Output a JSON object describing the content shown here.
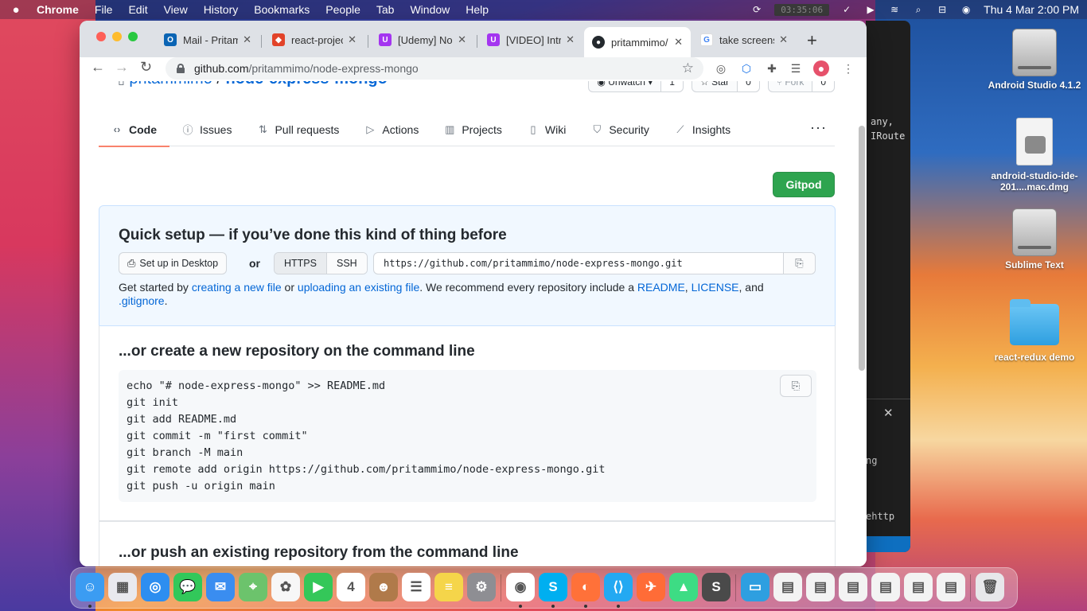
{
  "menubar": {
    "app": "Chrome",
    "items": [
      "File",
      "Edit",
      "View",
      "History",
      "Bookmarks",
      "People",
      "Tab",
      "Window",
      "Help"
    ],
    "timer": "03:35:06",
    "datetime": "Thu 4 Mar  2:00 PM"
  },
  "browser": {
    "tabs": [
      {
        "title": "Mail - Pritam",
        "icon": "outlook-icon",
        "color": "#0a64b4"
      },
      {
        "title": "react-project",
        "icon": "gitlab-icon",
        "color": "#e24329"
      },
      {
        "title": "[Udemy] Node",
        "icon": "udemy-icon",
        "color": "#a435f0"
      },
      {
        "title": "[VIDEO] Intro",
        "icon": "udemy-icon",
        "color": "#a435f0"
      },
      {
        "title": "pritammimo/",
        "icon": "github-icon",
        "color": "#24292e"
      },
      {
        "title": "take screens",
        "icon": "google-icon",
        "color": "#4285f4"
      }
    ],
    "url_domain": "github.com",
    "url_path": "/pritammimo/node-express-mongo"
  },
  "repo": {
    "owner": "pritammimo",
    "separator": " / ",
    "name": "node-express-mongo",
    "watch": {
      "label": "Unwatch",
      "count": "1"
    },
    "star": {
      "label": "Star",
      "count": "0"
    },
    "fork": {
      "label": "Fork",
      "count": "0"
    }
  },
  "nav": {
    "items": [
      {
        "label": "Code",
        "icon": "code-icon"
      },
      {
        "label": "Issues",
        "icon": "issue-icon"
      },
      {
        "label": "Pull requests",
        "icon": "pull-request-icon"
      },
      {
        "label": "Actions",
        "icon": "play-icon"
      },
      {
        "label": "Projects",
        "icon": "project-icon"
      },
      {
        "label": "Wiki",
        "icon": "book-icon"
      },
      {
        "label": "Security",
        "icon": "shield-icon"
      },
      {
        "label": "Insights",
        "icon": "graph-icon"
      }
    ],
    "more": "···"
  },
  "gitpod_label": "Gitpod",
  "quick_setup": {
    "title": "Quick setup — if you’ve done this kind of thing before",
    "desktop_btn": "Set up in Desktop",
    "or": "or",
    "https": "HTTPS",
    "ssh": "SSH",
    "clone_url": "https://github.com/pritammimo/node-express-mongo.git",
    "desc_1": "Get started by ",
    "link_new_file": "creating a new file",
    "desc_2": " or ",
    "link_upload": "uploading an existing file",
    "desc_3": ". We recommend every repository include a ",
    "link_readme": "README",
    "desc_4": ", ",
    "link_license": "LICENSE",
    "desc_5": ", and ",
    "link_gitignore": ".gitignore",
    "desc_6": "."
  },
  "cmd_new": {
    "title": "...or create a new repository on the command line",
    "code": "echo \"# node-express-mongo\" >> README.md\ngit init\ngit add README.md\ngit commit -m \"first commit\"\ngit branch -M main\ngit remote add origin https://github.com/pritammimo/node-express-mongo.git\ngit push -u origin main"
  },
  "cmd_push": {
    "title": "...or push an existing repository from the command line"
  },
  "desktop": {
    "icons": [
      {
        "label": "Android Studio 4.1.2",
        "kind": "disk"
      },
      {
        "label": "android-studio-ide-201....mac.dmg",
        "kind": "dmg"
      },
      {
        "label": "Sublime Text",
        "kind": "disk"
      },
      {
        "label": "react-redux demo",
        "kind": "folder"
      }
    ]
  },
  "bg_window": {
    "line1": "any,",
    "line2": "IRoute",
    "line3": "ng",
    "line4": "ehttp"
  },
  "dock": {
    "apps": [
      {
        "name": "finder-icon",
        "color": "#3b9cf2",
        "glyph": "☺"
      },
      {
        "name": "launchpad-icon",
        "color": "#e9e9ee",
        "glyph": "▦"
      },
      {
        "name": "safari-icon",
        "color": "#2d8ef0",
        "glyph": "◎"
      },
      {
        "name": "messages-icon",
        "color": "#32c85a",
        "glyph": "💬"
      },
      {
        "name": "mail-icon",
        "color": "#3a8df0",
        "glyph": "✉"
      },
      {
        "name": "maps-icon",
        "color": "#6cc36c",
        "glyph": "⌖"
      },
      {
        "name": "photos-icon",
        "color": "#f7f7f7",
        "glyph": "✿"
      },
      {
        "name": "facetime-icon",
        "color": "#34c759",
        "glyph": "▶"
      },
      {
        "name": "calendar-icon",
        "color": "#ffffff",
        "glyph": "4"
      },
      {
        "name": "contacts-icon",
        "color": "#b07a4a",
        "glyph": "☻"
      },
      {
        "name": "reminders-icon",
        "color": "#ffffff",
        "glyph": "☰"
      },
      {
        "name": "notes-icon",
        "color": "#f5d54a",
        "glyph": "≡"
      },
      {
        "name": "system-preferences-icon",
        "color": "#8e8e93",
        "glyph": "⚙"
      },
      {
        "name": "chrome-icon",
        "color": "#ffffff",
        "glyph": "◉"
      },
      {
        "name": "skype-icon",
        "color": "#00aff0",
        "glyph": "S"
      },
      {
        "name": "firefox-icon",
        "color": "#ff7139",
        "glyph": "◐"
      },
      {
        "name": "vscode-icon",
        "color": "#23a9f2",
        "glyph": "⟨⟩"
      },
      {
        "name": "postman-icon",
        "color": "#ff6c37",
        "glyph": "✈"
      },
      {
        "name": "android-studio-icon",
        "color": "#3ddc84",
        "glyph": "▲"
      },
      {
        "name": "sublime-icon",
        "color": "#4a4a4a",
        "glyph": "S"
      },
      {
        "name": "downloads-folder-icon",
        "color": "#2e9fe0",
        "glyph": "▭"
      },
      {
        "name": "screenshot-thumb-1-icon",
        "color": "#f3f3f3",
        "glyph": "▤"
      },
      {
        "name": "screenshot-thumb-2-icon",
        "color": "#f3f3f3",
        "glyph": "▤"
      },
      {
        "name": "screenshot-thumb-3-icon",
        "color": "#f3f3f3",
        "glyph": "▤"
      },
      {
        "name": "screenshot-thumb-4-icon",
        "color": "#f3f3f3",
        "glyph": "▤"
      },
      {
        "name": "screenshot-thumb-5-icon",
        "color": "#f3f3f3",
        "glyph": "▤"
      },
      {
        "name": "screenshot-thumb-6-icon",
        "color": "#f3f3f3",
        "glyph": "▤"
      },
      {
        "name": "trash-icon",
        "color": "#e7e7ea",
        "glyph": "🗑"
      }
    ]
  }
}
